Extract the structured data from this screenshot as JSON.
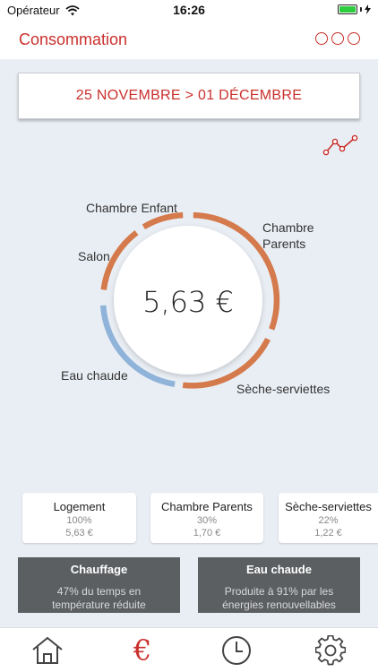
{
  "status_bar": {
    "carrier": "Opérateur",
    "time": "16:26"
  },
  "nav": {
    "title": "Consommation",
    "menu_icon": "more-circles-icon"
  },
  "period": {
    "label": "25 NOVEMBRE > 01 DÉCEMBRE"
  },
  "trend_icon": "trend-line-icon",
  "donut": {
    "total": "5,63 €",
    "segments": [
      {
        "name": "Chambre Enfant",
        "color": "#d47a4c"
      },
      {
        "name": "Chambre Parents",
        "color": "#d47a4c"
      },
      {
        "name": "Sèche-serviettes",
        "color": "#d47a4c"
      },
      {
        "name": "Eau chaude",
        "color": "#8fb3d9"
      },
      {
        "name": "Salon",
        "color": "#d47a4c"
      }
    ]
  },
  "cards": [
    {
      "title": "Logement",
      "percent": "100%",
      "value": "5,63 €"
    },
    {
      "title": "Chambre Parents",
      "percent": "30%",
      "value": "1,70 €"
    },
    {
      "title": "Sèche-serviettes",
      "percent": "22%",
      "value": "1,22 €"
    }
  ],
  "info": [
    {
      "title": "Chauffage",
      "line1": "47% du temps en",
      "line2": "température réduite"
    },
    {
      "title": "Eau chaude",
      "line1": "Produite à 91% par les",
      "line2": "énergies renouvellables"
    }
  ],
  "tabs": [
    {
      "name": "home",
      "icon": "home-icon"
    },
    {
      "name": "consumption",
      "icon": "euro-icon",
      "label": "€",
      "active": true
    },
    {
      "name": "history",
      "icon": "clock-icon"
    },
    {
      "name": "settings",
      "icon": "gear-icon"
    }
  ],
  "colors": {
    "accent": "#c9302c",
    "heating": "#d47a4c",
    "water": "#8fb3d9",
    "info_bg": "#5c5f62"
  }
}
